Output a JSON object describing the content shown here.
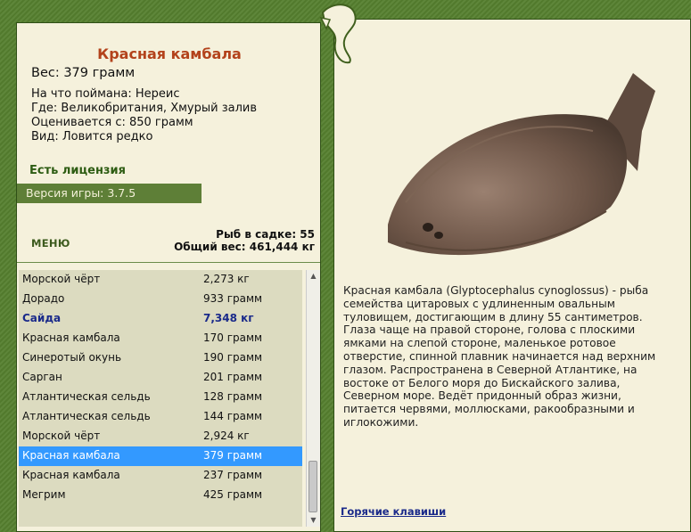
{
  "fish": {
    "name": "Красная камбала",
    "weight": "Вес: 379 грамм",
    "caught_on": "На что поймана: Нереис",
    "location": "Где: Великобритания, Хмурый залив",
    "value": "Оценивается с: 850 грамм",
    "kind": "Вид: Ловится редко"
  },
  "license": "Есть лицензия",
  "version": "Версия игры: 3.7.5",
  "menu_label": "МЕНЮ",
  "keep_count": "Рыб в садке: 55",
  "total_weight": "Общий вес: 461,444 кг",
  "catch_list": [
    {
      "name": "Морской чёрт",
      "weight": "2,273 кг"
    },
    {
      "name": "Дорадо",
      "weight": "933 грамм"
    },
    {
      "name": "Сайда",
      "weight": "7,348 кг"
    },
    {
      "name": "Красная камбала",
      "weight": "170 грамм"
    },
    {
      "name": "Синеротый окунь",
      "weight": "190 грамм"
    },
    {
      "name": "Сарган",
      "weight": "201 грамм"
    },
    {
      "name": "Атлантическая сельдь",
      "weight": "128 грамм"
    },
    {
      "name": "Атлантическая сельдь",
      "weight": "144 грамм"
    },
    {
      "name": "Морской чёрт",
      "weight": "2,924 кг"
    },
    {
      "name": "Красная камбала",
      "weight": "379 грамм"
    },
    {
      "name": "Красная камбала",
      "weight": "237 грамм"
    },
    {
      "name": "Мегрим",
      "weight": "425 грамм"
    }
  ],
  "description": [
    "Красная камбала (Glyptocephalus cynoglossus) - рыба",
    "семейства цитаровых с удлиненным овальным",
    "туловищем, достигающим в длину 55 сантиметров.",
    "Глаза чаще на правой стороне, голова с плоскими",
    "ямками на слепой стороне, маленькое ротовое",
    "отверстие, спинной плавник начинается над верхним",
    "глазом. Распространена в Северной Атлантике, на",
    "востоке от Белого моря до Бискайского залива,",
    "Северном море. Ведёт придонный образ жизни,",
    "питается червями, моллюсками, ракообразными и",
    "иглокожими."
  ],
  "hotkeys": "Горячие клавиши",
  "icons": {
    "emblem": "seahorse-emblem-icon",
    "scroll_up": "arrow-up-icon",
    "scroll_down": "arrow-down-icon"
  }
}
